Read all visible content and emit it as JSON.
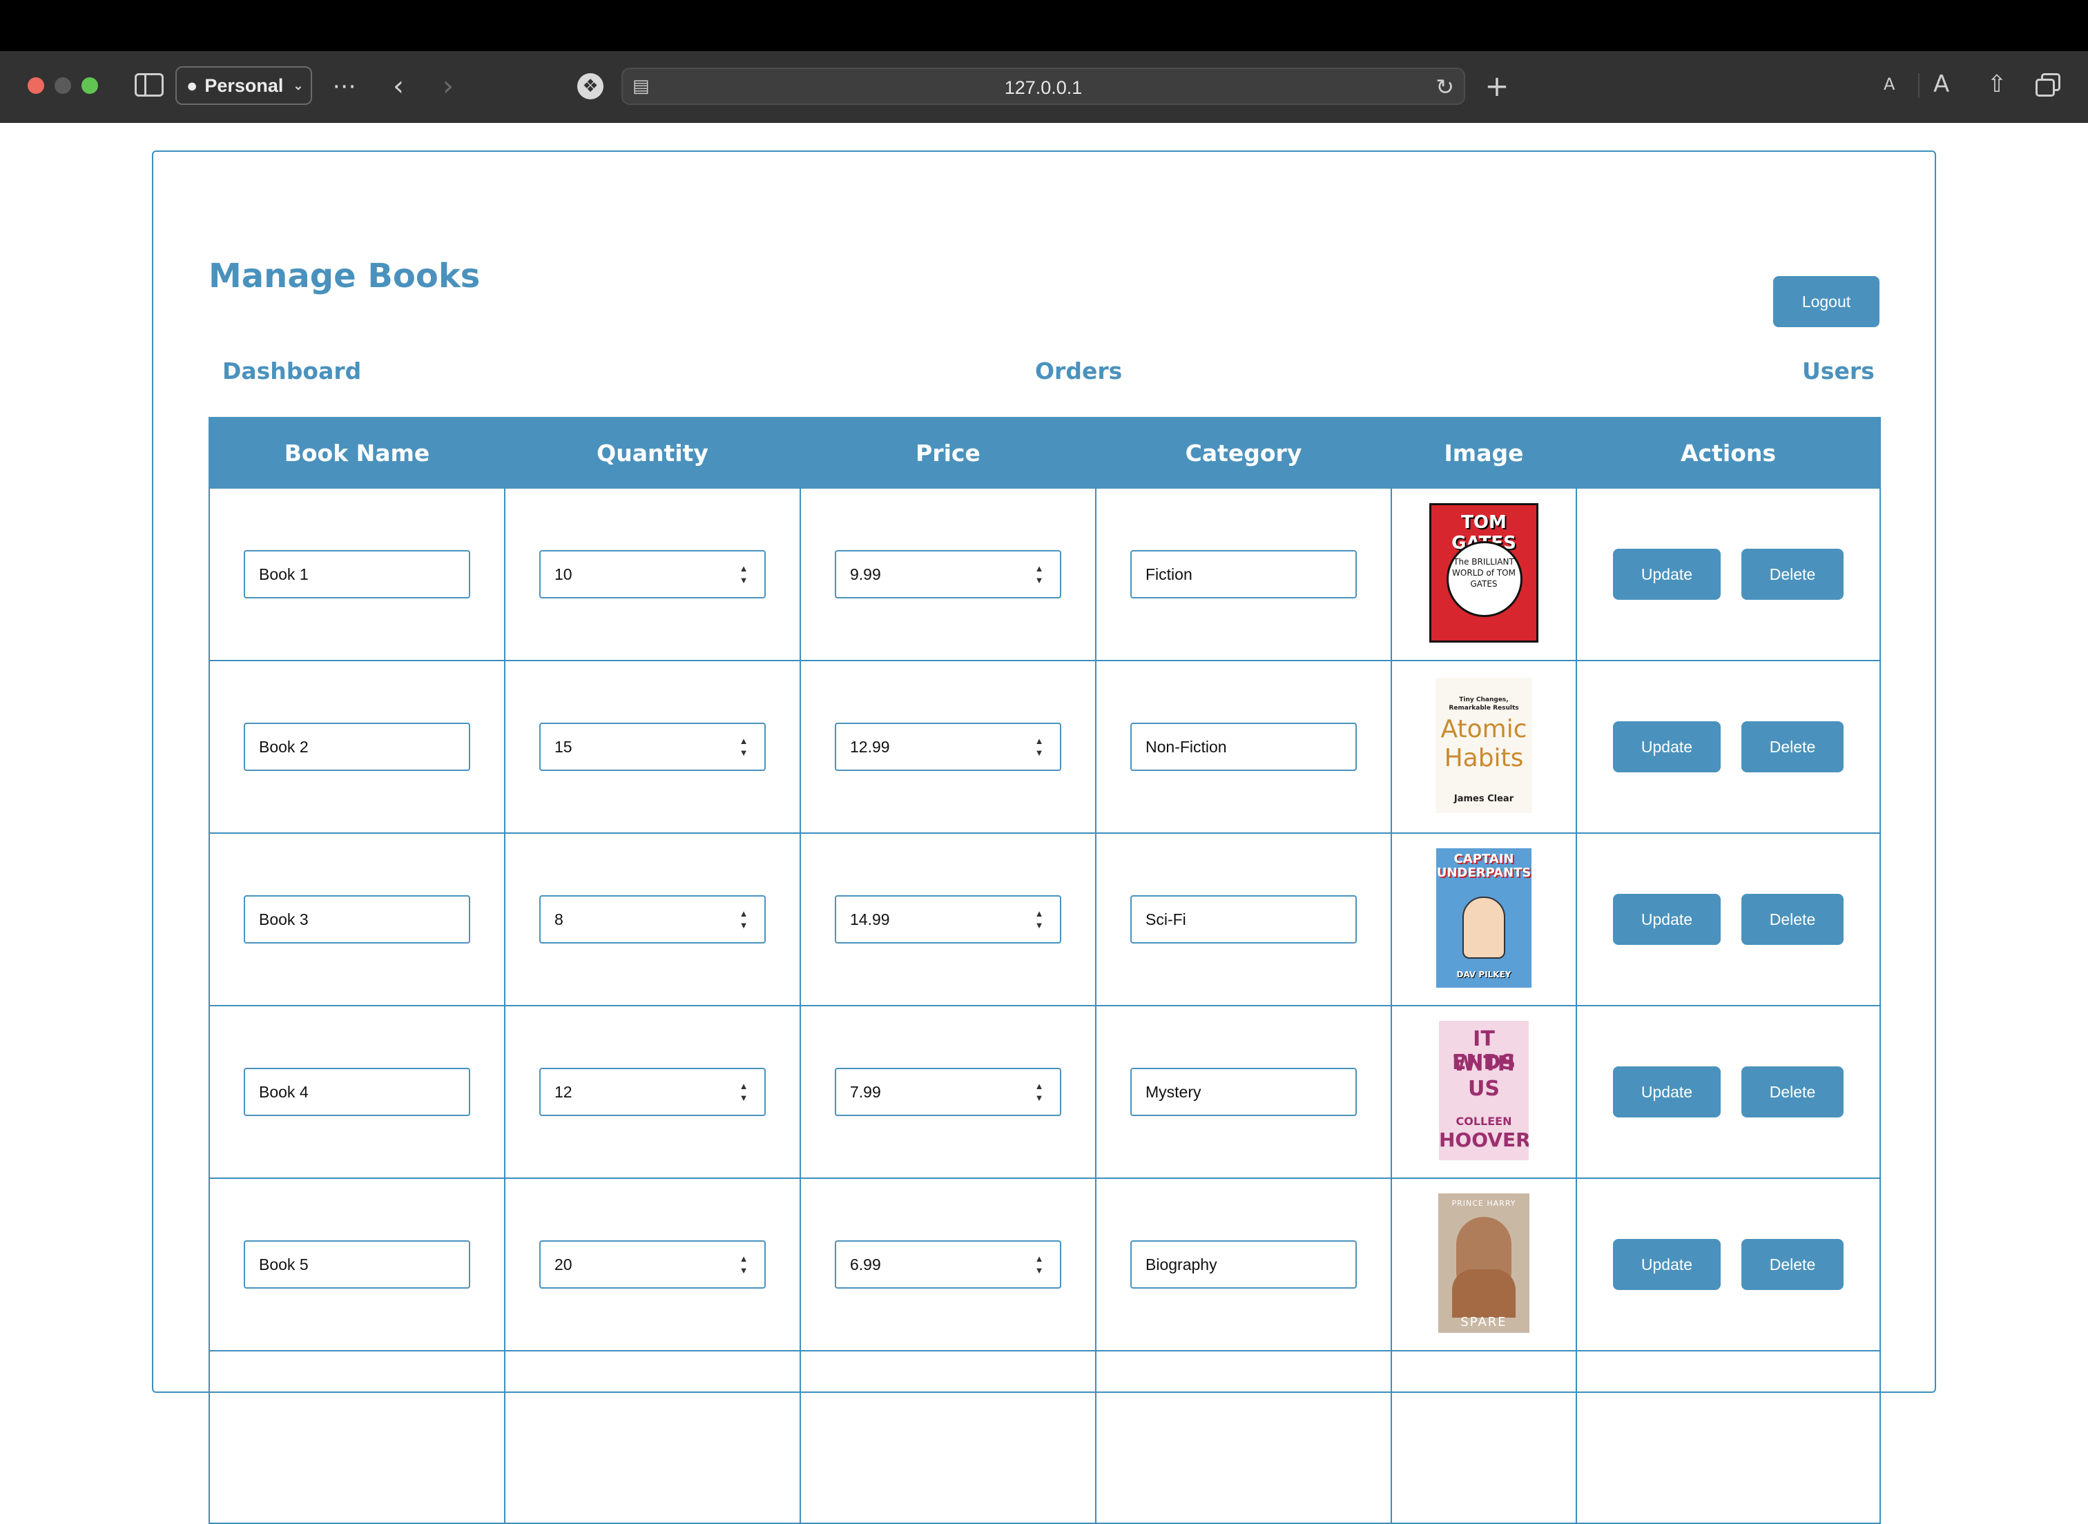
{
  "browser": {
    "profile_label": "Personal",
    "address": "127.0.0.1"
  },
  "page": {
    "title": "Manage Books",
    "logout_label": "Logout",
    "nav": {
      "dashboard": "Dashboard",
      "orders": "Orders",
      "users": "Users"
    }
  },
  "table": {
    "headers": [
      "Book Name",
      "Quantity",
      "Price",
      "Category",
      "Image",
      "Actions"
    ],
    "rows": [
      {
        "name": "Book 1",
        "quantity": "10",
        "price": "9.99",
        "category": "Fiction",
        "cover": "tom-gates-cover",
        "update_label": "Update",
        "delete_label": "Delete"
      },
      {
        "name": "Book 2",
        "quantity": "15",
        "price": "12.99",
        "category": "Non-Fiction",
        "cover": "atomic-habits-cover",
        "update_label": "Update",
        "delete_label": "Delete"
      },
      {
        "name": "Book 3",
        "quantity": "8",
        "price": "14.99",
        "category": "Sci-Fi",
        "cover": "captain-underpants-cover",
        "update_label": "Update",
        "delete_label": "Delete"
      },
      {
        "name": "Book 4",
        "quantity": "12",
        "price": "7.99",
        "category": "Mystery",
        "cover": "it-ends-with-us-cover",
        "update_label": "Update",
        "delete_label": "Delete"
      },
      {
        "name": "Book 5",
        "quantity": "20",
        "price": "6.99",
        "category": "Biography",
        "cover": "spare-cover",
        "update_label": "Update",
        "delete_label": "Delete"
      }
    ]
  },
  "covers": {
    "tom_gates": {
      "title": "TOM GATES",
      "subtitle": "The BRILLIANT WORLD of TOM GATES"
    },
    "atomic_habits": {
      "tagline": "Tiny Changes, Remarkable Results",
      "title1": "Atomic",
      "title2": "Habits",
      "author": "James Clear"
    },
    "captain_underpants": {
      "title": "CAPTAIN UNDERPANTS",
      "author": "DAV PILKEY"
    },
    "it_ends": {
      "title1": "IT ENDS",
      "title2": "WITH",
      "title3": "US",
      "author1": "COLLEEN",
      "author2": "HOOVER"
    },
    "spare": {
      "author": "PRINCE HARRY",
      "title": "SPARE"
    }
  },
  "colors": {
    "accent": "#4a92bd",
    "border": "#3d8ebd"
  }
}
